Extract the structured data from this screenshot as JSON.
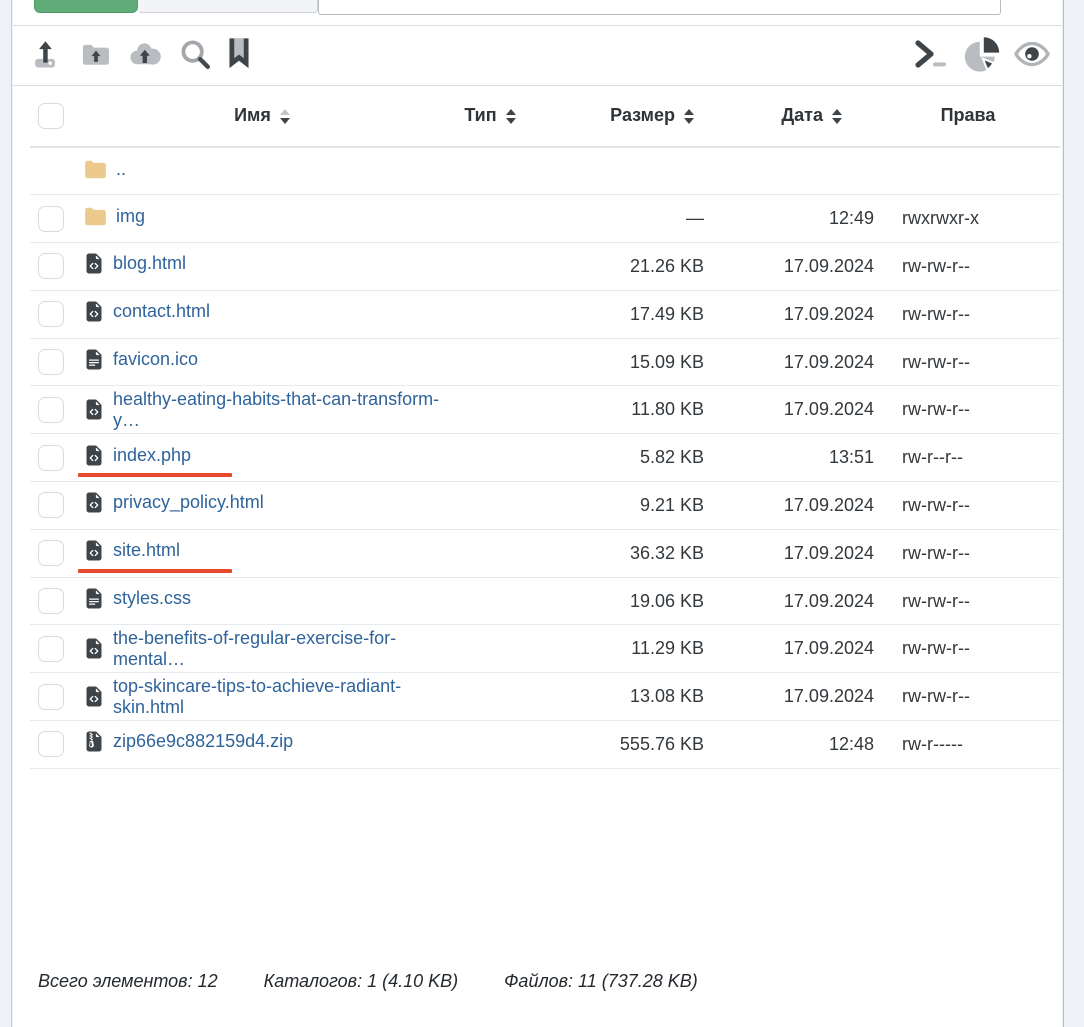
{
  "colors": {
    "accent_green": "#60ac79",
    "underline_red": "#e8492e",
    "link_blue": "#2f639b",
    "folder_tan": "#ecc98c",
    "icon_dark": "#3f4449",
    "icon_gray": "#b9bdc1"
  },
  "topbar": {
    "path_input_value": ""
  },
  "toolbar": {
    "left_icons": [
      "upload",
      "folder-upload",
      "cloud-upload",
      "search",
      "bookmark"
    ],
    "right_icons": [
      "terminal",
      "pie-chart",
      "eye"
    ]
  },
  "table": {
    "headers": [
      {
        "label": "Имя",
        "sortable": true,
        "sort": "asc"
      },
      {
        "label": "Тип",
        "sortable": true
      },
      {
        "label": "Размер",
        "sortable": true
      },
      {
        "label": "Дата",
        "sortable": true
      },
      {
        "label": "Права",
        "sortable": false
      }
    ],
    "rows": [
      {
        "name": "..",
        "icon": "folder",
        "checkbox": false,
        "size": "",
        "date": "",
        "perms": ""
      },
      {
        "name": "img",
        "icon": "folder",
        "checkbox": true,
        "size": "—",
        "date": "12:49",
        "perms": "rwxrwxr-x"
      },
      {
        "name": "blog.html",
        "icon": "file-code",
        "checkbox": true,
        "size": "21.26 KB",
        "date": "17.09.2024",
        "perms": "rw-rw-r--"
      },
      {
        "name": "contact.html",
        "icon": "file-code",
        "checkbox": true,
        "size": "17.49 KB",
        "date": "17.09.2024",
        "perms": "rw-rw-r--"
      },
      {
        "name": "favicon.ico",
        "icon": "file-text",
        "checkbox": true,
        "size": "15.09 KB",
        "date": "17.09.2024",
        "perms": "rw-rw-r--"
      },
      {
        "name": "healthy-eating-habits-that-can-transform-y…",
        "icon": "file-code",
        "checkbox": true,
        "size": "11.80 KB",
        "date": "17.09.2024",
        "perms": "rw-rw-r--"
      },
      {
        "name": "index.php",
        "icon": "file-code",
        "checkbox": true,
        "size": "5.82 KB",
        "date": "13:51",
        "perms": "rw-r--r--",
        "underline": true
      },
      {
        "name": "privacy_policy.html",
        "icon": "file-code",
        "checkbox": true,
        "size": "9.21 KB",
        "date": "17.09.2024",
        "perms": "rw-rw-r--"
      },
      {
        "name": "site.html",
        "icon": "file-code",
        "checkbox": true,
        "size": "36.32 KB",
        "date": "17.09.2024",
        "perms": "rw-rw-r--",
        "underline": true
      },
      {
        "name": "styles.css",
        "icon": "file-text",
        "checkbox": true,
        "size": "19.06 KB",
        "date": "17.09.2024",
        "perms": "rw-rw-r--"
      },
      {
        "name": "the-benefits-of-regular-exercise-for-mental…",
        "icon": "file-code",
        "checkbox": true,
        "size": "11.29 KB",
        "date": "17.09.2024",
        "perms": "rw-rw-r--"
      },
      {
        "name": "top-skincare-tips-to-achieve-radiant-skin.html",
        "icon": "file-code",
        "checkbox": true,
        "size": "13.08 KB",
        "date": "17.09.2024",
        "perms": "rw-rw-r--"
      },
      {
        "name": "zip66e9c882159d4.zip",
        "icon": "file-zip",
        "checkbox": true,
        "size": "555.76 KB",
        "date": "12:48",
        "perms": "rw-r-----"
      }
    ]
  },
  "footer": {
    "total": "Всего элементов: 12",
    "dirs": "Каталогов: 1 (4.10 KB)",
    "files": "Файлов: 11 (737.28 KB)"
  }
}
